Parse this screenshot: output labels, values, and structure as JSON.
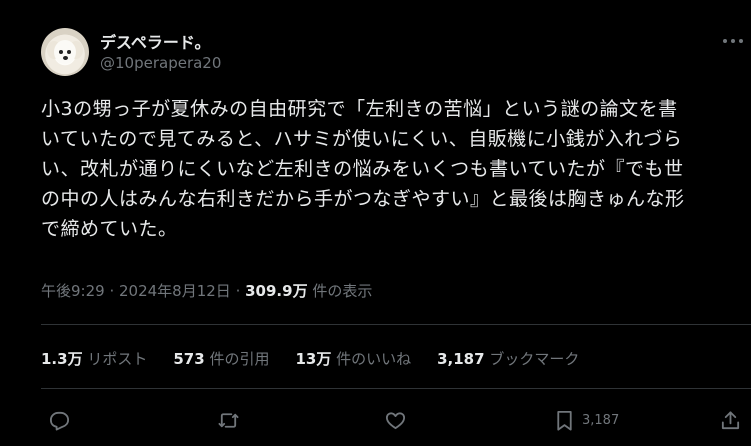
{
  "author": {
    "display_name": "デスペラード。",
    "handle": "@10perapera20"
  },
  "tweet": {
    "lines": [
      "小3の甥っ子が夏休みの自由研究で「左利きの苦悩」という謎の論文を書",
      "いていたので見てみると、ハサミが使いにくい、自販機に小銭が入れづら",
      "い、改札が通りにくいなど左利きの悩みをいくつも書いていたが『でも世",
      "の中の人はみんな右利きだから手がつなぎやすい』と最後は胸きゅんな形",
      "で締めていた。"
    ]
  },
  "meta": {
    "time": "午後9:29",
    "sep1": " · ",
    "date": "2024年8月12日",
    "sep2": " · ",
    "views": "309.9万",
    "views_label": " 件の表示"
  },
  "stats": {
    "reposts": "1.3万",
    "reposts_label": " リポスト",
    "quotes": "573",
    "quotes_label": " 件の引用",
    "likes": "13万",
    "likes_label": " 件のいいね",
    "bookmarks": "3,187",
    "bookmarks_label": " ブックマーク"
  },
  "actions": {
    "bookmark_count": "3,187"
  },
  "icons": {
    "reply": "reply-icon",
    "repost": "repost-icon",
    "like": "like-icon",
    "bookmark": "bookmark-icon",
    "share": "share-icon",
    "more": "more-icon"
  }
}
